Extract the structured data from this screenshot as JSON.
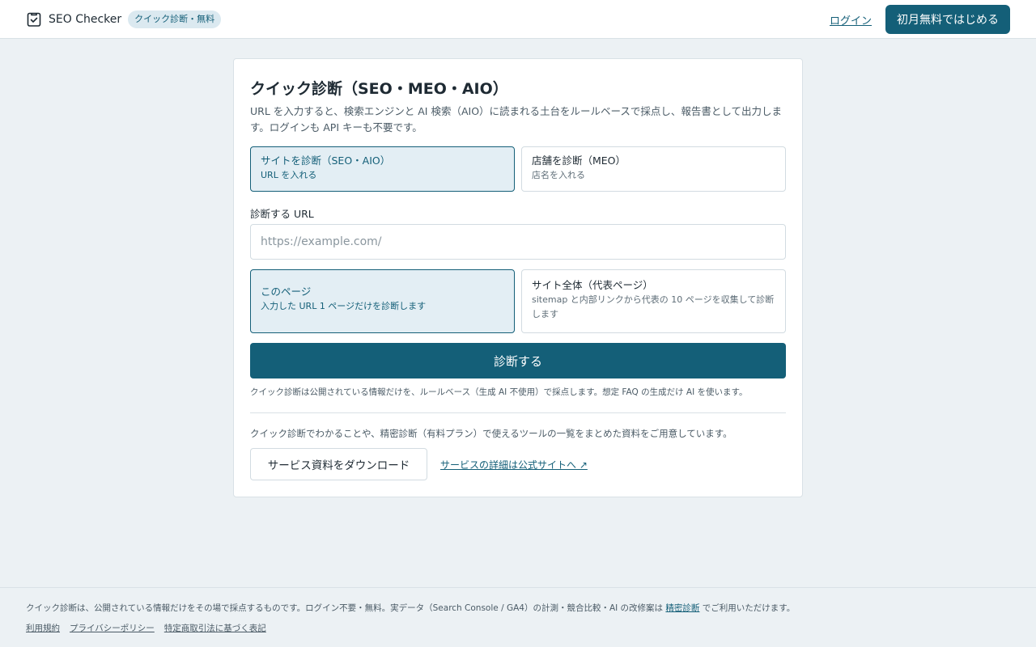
{
  "colors": {
    "accent": "#145f78",
    "background": "#ecf1f4",
    "selected_bg": "#e3eef4"
  },
  "header": {
    "logo_icon": "clipboard-check-icon",
    "brand": "SEO Checker",
    "badge": "クイック診断・無料",
    "login": "ログイン",
    "cta": "初月無料ではじめる"
  },
  "card": {
    "title": "クイック診断（SEO・MEO・AIO）",
    "description": "URL を入力すると、検索エンジンと AI 検索（AIO）に読まれる土台をルールベースで採点し、報告書として出力します。ログインも API キーも不要です。",
    "modes": [
      {
        "title": "サイトを診断（SEO・AIO）",
        "sub": "URL を入れる",
        "selected": true
      },
      {
        "title": "店舗を診断（MEO）",
        "sub": "店名を入れる",
        "selected": false
      }
    ],
    "url_label": "診断する URL",
    "url_placeholder": "https://example.com/",
    "url_value": "",
    "scopes": [
      {
        "title": "このページ",
        "sub": "入力した URL 1 ページだけを診断します",
        "selected": true
      },
      {
        "title": "サイト全体（代表ページ）",
        "sub": "sitemap と内部リンクから代表の 10 ページを収集して診断します",
        "selected": false
      }
    ],
    "submit": "診断する",
    "note": "クイック診断は公開されている情報だけを、ルールベース（生成 AI 不使用）で採点します。想定 FAQ の生成だけ AI を使います。",
    "promo": "クイック診断でわかることや、精密診断（有料プラン）で使えるツールの一覧をまとめた資料をご用意しています。",
    "download": "サービス資料をダウンロード",
    "details_link": "サービスの詳細は公式サイトへ ↗"
  },
  "footer": {
    "text_before": "クイック診断は、公開されている情報だけをその場で採点するものです。ログイン不要・無料。実データ（Search Console / GA4）の計測・競合比較・AI の改修案は ",
    "text_link": "精密診断",
    "text_after": " でご利用いただけます。",
    "links": [
      "利用規約",
      "プライバシーポリシー",
      "特定商取引法に基づく表記"
    ]
  }
}
